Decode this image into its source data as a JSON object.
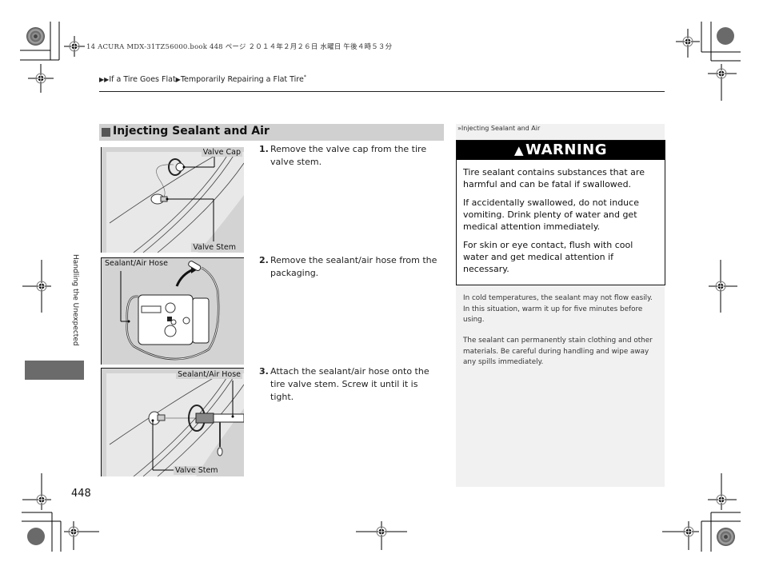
{
  "print_header": "14 ACURA MDX-31TZ56000.book  448 ページ  ２０１４年２月２６日  水曜日  午後４時５３分",
  "breadcrumb": {
    "prefix_arrows": "▶▶",
    "item1": "If a Tire Goes Flat",
    "separator": "▶",
    "item2": "Temporarily Repairing a Flat Tire",
    "asterisk": "*"
  },
  "section": {
    "title": "Injecting Sealant and Air"
  },
  "figures": [
    {
      "labels": [
        "Valve Cap",
        "Valve Stem"
      ]
    },
    {
      "labels": [
        "Sealant/Air Hose"
      ]
    },
    {
      "labels": [
        "Sealant/Air Hose",
        "Valve Stem"
      ]
    }
  ],
  "steps": [
    {
      "num": "1.",
      "text": "Remove the valve cap from the tire valve stem."
    },
    {
      "num": "2.",
      "text": "Remove the sealant/air hose from the packaging."
    },
    {
      "num": "3.",
      "text": "Attach the sealant/air hose onto the tire valve stem. Screw it until it is tight."
    }
  ],
  "side_panel": {
    "ref_icon": "»",
    "ref_title": "Injecting Sealant and Air",
    "warning": {
      "icon": "▲",
      "title": "WARNING",
      "paragraphs": [
        "Tire sealant contains substances that are harmful and can be fatal if swallowed.",
        "If accidentally swallowed, do not induce vomiting. Drink plenty of water and get medical attention immediately.",
        "For skin or eye contact, flush with cool water and get medical attention if necessary."
      ]
    },
    "notes": [
      "In cold temperatures, the sealant may not flow easily. In this situation, warm it up for five minutes before using.",
      "The sealant can permanently stain clothing and other materials. Be careful during handling and wipe away any spills immediately."
    ]
  },
  "chapter": {
    "label": "Handling the Unexpected"
  },
  "page_number": "448"
}
